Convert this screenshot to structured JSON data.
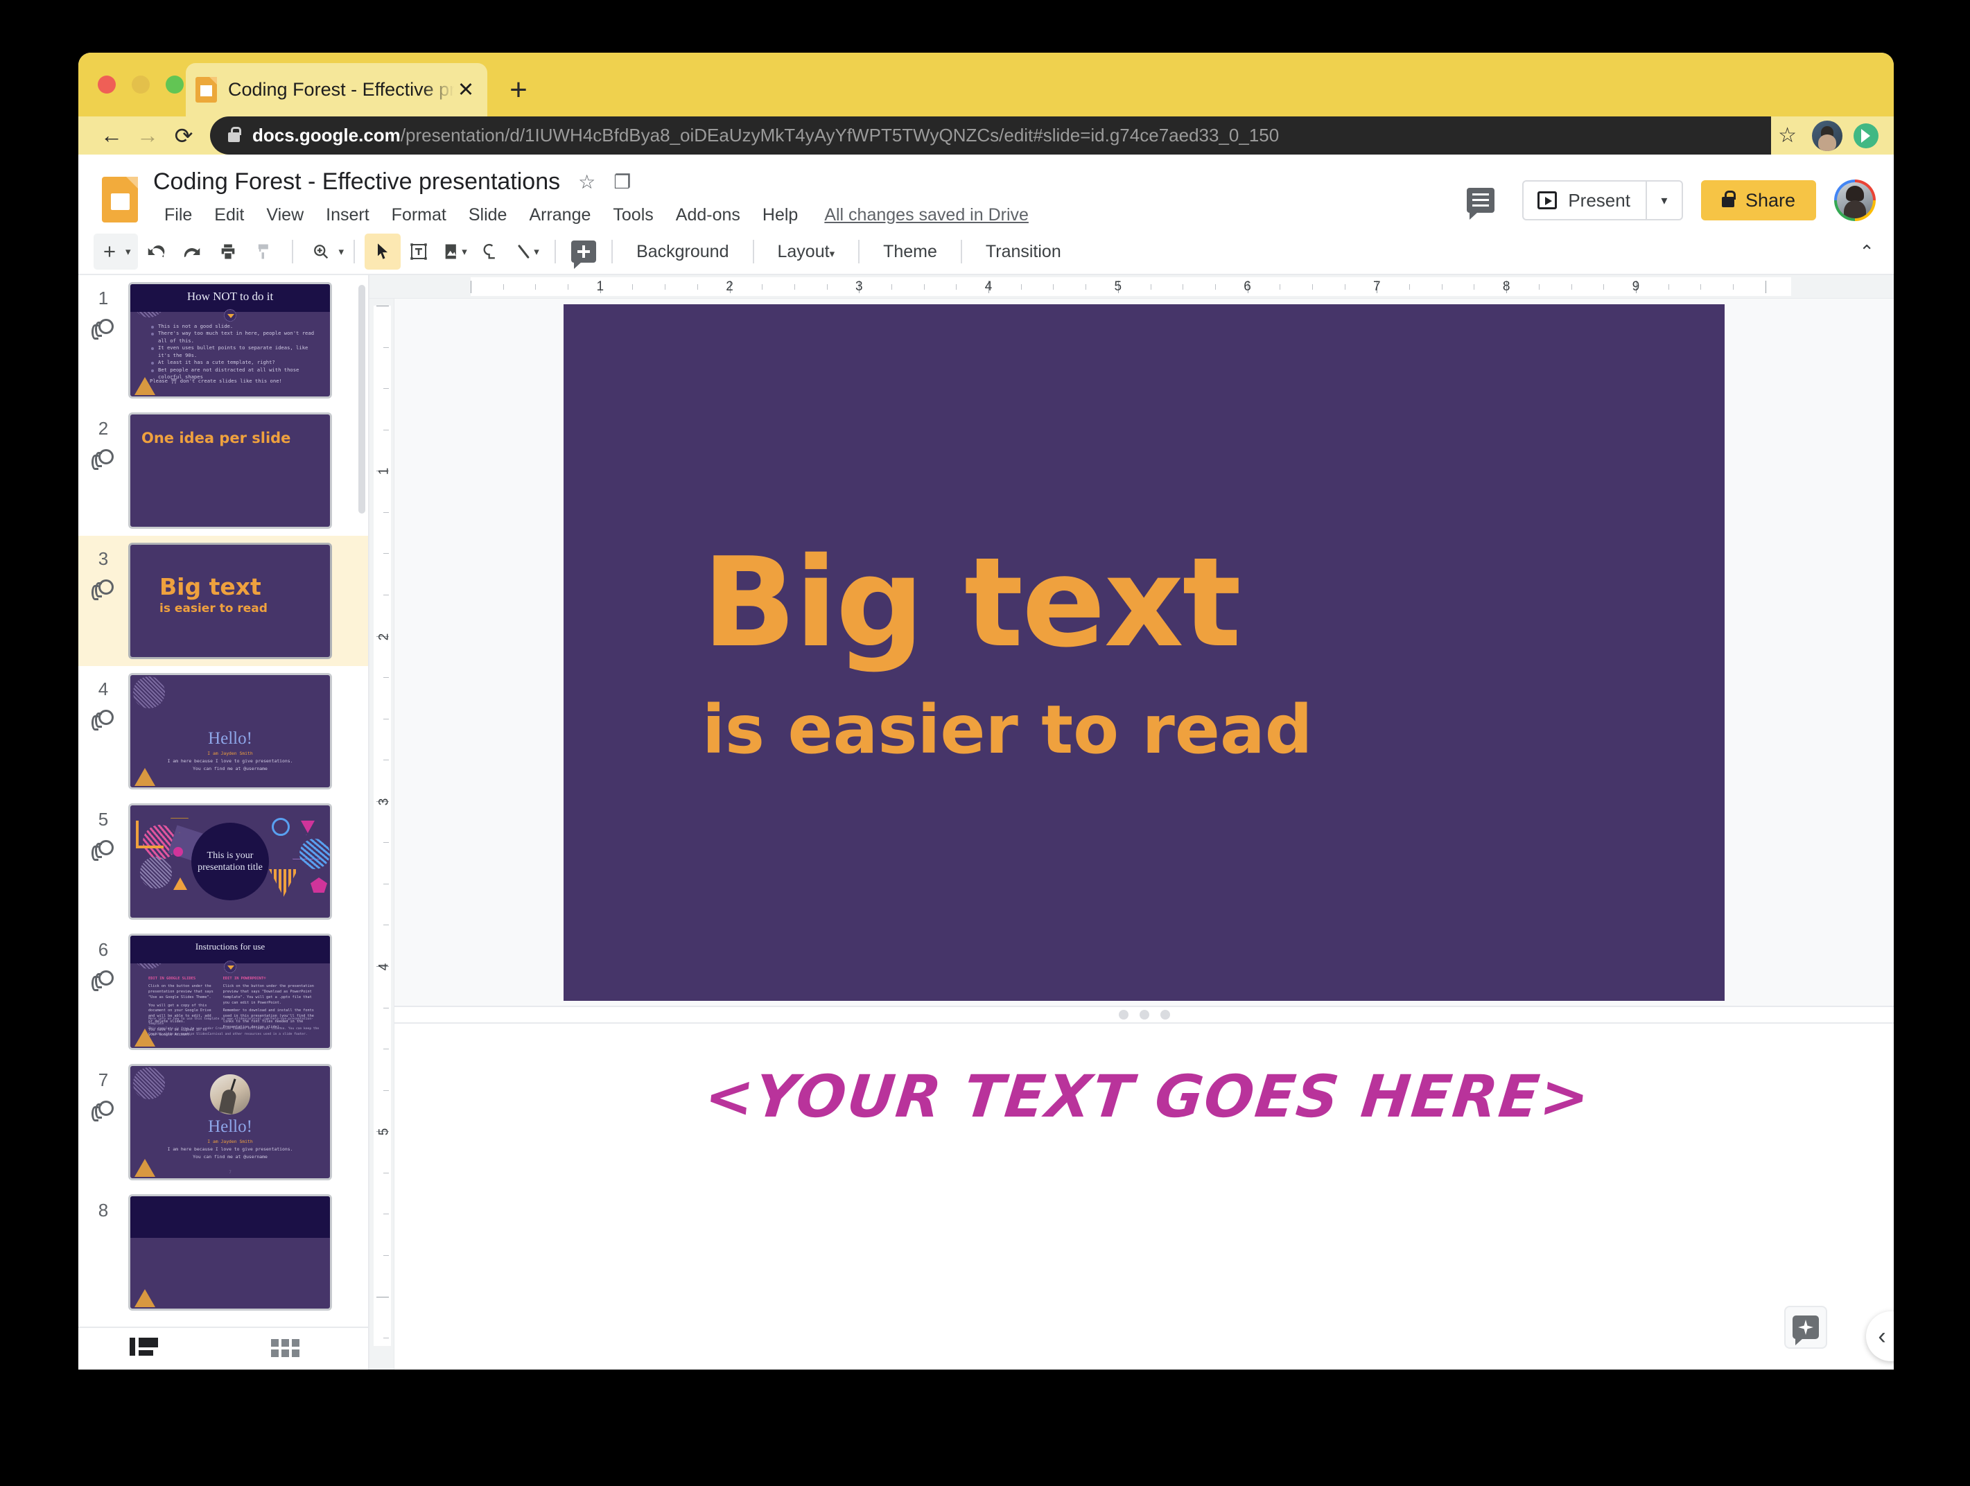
{
  "browser": {
    "tab": {
      "title": "Coding Forest - Effective presentations",
      "favicon": "slides-favicon",
      "close": "✕"
    },
    "newtab_label": "+",
    "nav": {
      "back": "←",
      "forward": "→",
      "reload": "⟳"
    },
    "url": {
      "host": "docs.google.com",
      "path": "/presentation/d/1IUWH4cBfdBya8_oiDEaUzyMkT4yAyYfWPT5TWyQNZCs/edit#slide=id.g74ce7aed33_0_150"
    },
    "bookmark_star": "☆"
  },
  "app": {
    "doc_title": "Coding Forest - Effective presentations",
    "title_icons": {
      "star": "☆",
      "move_to_folder": "❐"
    },
    "menus": [
      "File",
      "Edit",
      "View",
      "Insert",
      "Format",
      "Slide",
      "Arrange",
      "Tools",
      "Add-ons",
      "Help"
    ],
    "save_status": "All changes saved in Drive",
    "present_label": "Present",
    "present_caret": "▾",
    "share_label": "Share"
  },
  "toolbar": {
    "items": [
      {
        "name": "new-slide",
        "icon": "plus-icon",
        "caret": true,
        "grouped": true
      },
      {
        "name": "undo",
        "icon": "undo-icon"
      },
      {
        "name": "redo",
        "icon": "redo-icon"
      },
      {
        "name": "print",
        "icon": "print-icon"
      },
      {
        "name": "paint-format",
        "icon": "paint-format-icon"
      },
      {
        "name": "zoom",
        "icon": "zoom-icon",
        "caret": true
      },
      {
        "name": "select",
        "icon": "cursor-icon",
        "active": true
      },
      {
        "name": "text-box",
        "icon": "text-box-icon"
      },
      {
        "name": "insert-image",
        "icon": "image-icon",
        "caret": true
      },
      {
        "name": "shape",
        "icon": "shape-icon"
      },
      {
        "name": "line",
        "icon": "line-icon",
        "caret": true
      },
      {
        "name": "insert-comment",
        "icon": "comment-plus-icon"
      }
    ],
    "text_buttons": [
      {
        "label": "Background",
        "caret": false
      },
      {
        "label": "Layout",
        "caret": true
      },
      {
        "label": "Theme",
        "caret": false
      },
      {
        "label": "Transition",
        "caret": false
      }
    ],
    "collapse_caret": "⌃"
  },
  "filmstrip": {
    "view_buttons": [
      {
        "name": "filmstrip-view",
        "active": true
      },
      {
        "name": "grid-view",
        "active": false
      }
    ],
    "slides": [
      {
        "number": "1",
        "kind": "bullets",
        "title": "How NOT to do it",
        "bullets": [
          "This is not a good slide.",
          "There's way too much text in here, people won't read all of this.",
          "It even uses bullet points to separate ideas, like it's the 90s.",
          "At least it has a cute template, right?",
          "Bet people are not distracted at all with those colorful shapes"
        ],
        "footer": "Please ⛩ don't create slides like this one!",
        "selected": false
      },
      {
        "number": "2",
        "kind": "heading",
        "heading": "One idea per slide",
        "selected": false
      },
      {
        "number": "3",
        "kind": "bigtext",
        "line1": "Big text",
        "line2": "is easier to read",
        "selected": true
      },
      {
        "number": "4",
        "kind": "hello",
        "heading": "Hello!",
        "name_line": "I am Jayden Smith",
        "sub_line_1": "I am here because I love to give presentations.",
        "sub_line_2": "You can find me at @username",
        "selected": false
      },
      {
        "number": "5",
        "kind": "title-circle",
        "circle_title": "This is your presentation title",
        "selected": false
      },
      {
        "number": "6",
        "kind": "instructions",
        "title": "Instructions for use",
        "col1_heading": "EDIT IN GOOGLE SLIDES",
        "col1_paras": [
          "Click on the button under the presentation preview that says \"Use as Google Slides Theme\".",
          "You will get a copy of this document on your Google Drive and will be able to edit, add or delete slides.",
          "You have to be signed in to your Google Account."
        ],
        "col2_heading": "EDIT IN POWERPOINT®",
        "col2_paras": [
          "Click on the button under the presentation preview that says \"Download as PowerPoint template\". You will get a .pptx file that you can edit in PowerPoint.",
          "Remember to download and install the fonts used in this presentation (you'll find the links to the font files needed in the Presentation design slide)."
        ],
        "foot_1": "More info on how to use this template at www.slidescarnival.com/help-use-presentation-template",
        "foot_2": "This template is free to use under Creative Commons Attribution license. You can keep the Credits slide or mention SlidesCarnival and other resources used in a slide footer.",
        "selected": false
      },
      {
        "number": "7",
        "kind": "hello-photo",
        "heading": "Hello!",
        "name_line": "I am Jayden Smith",
        "sub_line_1": "I am here because I love to give presentations.",
        "sub_line_2": "You can find me at @username",
        "page_num": "7",
        "selected": false
      },
      {
        "number": "8",
        "kind": "partial",
        "selected": false
      }
    ]
  },
  "editor": {
    "ruler_h_labels": [
      "1",
      "2",
      "3",
      "4",
      "5",
      "6",
      "7",
      "8",
      "9"
    ],
    "ruler_v_labels": [
      "1",
      "2",
      "3",
      "4",
      "5"
    ],
    "slide": {
      "line1": "Big text",
      "line2": "is easier to read",
      "background_color": "#463569",
      "text_color": "#efa13e"
    },
    "notes": {
      "text": "<YOUR TEXT GOES HERE>",
      "color": "#b9339b"
    },
    "explore_icon": "explore-sparkle-icon",
    "collapse_icon": "‹"
  },
  "colors": {
    "browser_chrome": "#efd14e",
    "omnibox": "#272727",
    "slides_accent": "#f2ab3c",
    "share_yellow": "#f6c445",
    "selected_row": "#fdf3d7"
  }
}
